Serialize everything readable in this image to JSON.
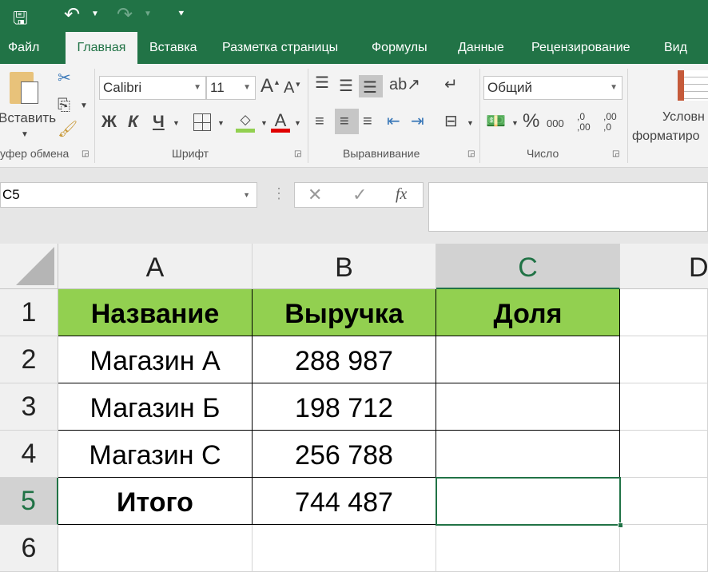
{
  "colors": {
    "accent": "#217346",
    "header_fill": "#92d050"
  },
  "titlebar": {
    "icons": [
      "save-icon",
      "undo-icon",
      "redo-icon",
      "customize-icon"
    ]
  },
  "tabs": [
    {
      "label": "Файл"
    },
    {
      "label": "Главная",
      "active": true
    },
    {
      "label": "Вставка"
    },
    {
      "label": "Разметка страницы"
    },
    {
      "label": "Формулы"
    },
    {
      "label": "Данные"
    },
    {
      "label": "Рецензирование"
    },
    {
      "label": "Вид"
    }
  ],
  "ribbon": {
    "clipboard": {
      "paste": "Вставить",
      "group": "уфер обмена"
    },
    "font": {
      "name": "Calibri",
      "size": "11",
      "bold": "Ж",
      "italic": "К",
      "underline": "Ч",
      "group": "Шрифт"
    },
    "alignment": {
      "group": "Выравнивание"
    },
    "number": {
      "format": "Общий",
      "percent": "%",
      "thousands": "000",
      "inc_decimal": ",0 ,00",
      "dec_decimal": ",00 ,0",
      "group": "Число"
    },
    "styles": {
      "cond_line1": "Условн",
      "cond_line2": "форматиро"
    }
  },
  "formula_bar": {
    "name_box": "C5",
    "cancel": "✕",
    "enter": "✓",
    "fx": "fx",
    "value": ""
  },
  "sheet": {
    "columns": [
      "A",
      "B",
      "C",
      "D"
    ],
    "rows": [
      "1",
      "2",
      "3",
      "4",
      "5",
      "6"
    ],
    "selected_cell": "C5",
    "cells": [
      [
        "Название",
        "Выручка",
        "Доля"
      ],
      [
        "Магазин А",
        "288 987",
        ""
      ],
      [
        "Магазин Б",
        "198 712",
        ""
      ],
      [
        "Магазин С",
        "256 788",
        ""
      ],
      [
        "Итого",
        "744 487",
        ""
      ]
    ]
  }
}
